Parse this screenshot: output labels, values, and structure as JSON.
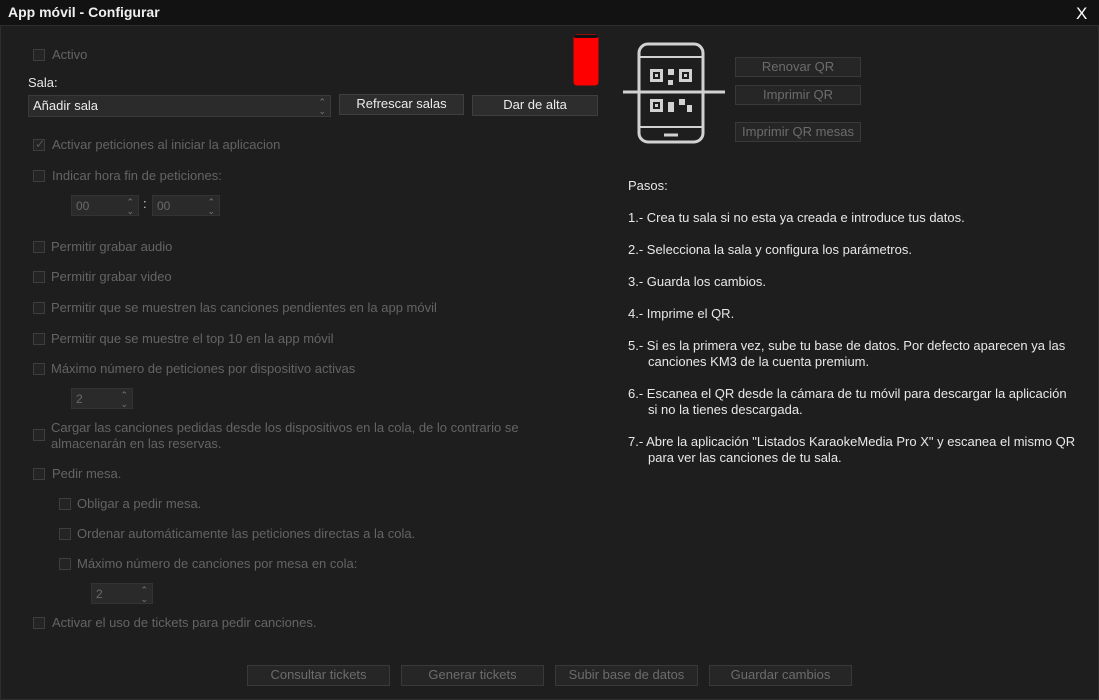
{
  "window": {
    "title": "App móvil - Configurar",
    "close_label": "X"
  },
  "settings": {
    "active_label": "Activo",
    "sala_label": "Sala:",
    "sala_selected": "Añadir sala",
    "refresh_rooms": "Refrescar salas",
    "register": "Dar de alta",
    "activate_requests": "Activar peticiones al iniciar la aplicacion",
    "end_time_label": "Indicar hora fin de peticiones:",
    "hour": "00",
    "time_sep": ":",
    "minute": "00",
    "allow_audio": "Permitir grabar audio",
    "allow_video": "Permitir grabar video",
    "show_pending": "Permitir que se muestren las canciones pendientes en la app móvil",
    "show_top10": "Permitir que se muestre el top 10 en la app móvil",
    "max_requests_label": "Máximo número de peticiones por dispositivo activas",
    "max_requests_value": "2",
    "load_queue_line1": "Cargar las canciones pedidas desde los dispositivos en la cola, de lo contrario se",
    "load_queue_line2": "almacenarán en las reservas.",
    "ask_table": "Pedir mesa.",
    "force_table": "Obligar a pedir mesa.",
    "auto_order": "Ordenar automáticamente las peticiones directas a la cola.",
    "max_songs_label": "Máximo número de canciones por mesa en cola:",
    "max_songs_value": "2",
    "tickets": "Activar el uso de tickets para pedir canciones."
  },
  "qr": {
    "renew": "Renovar QR",
    "print": "Imprimir QR",
    "print_tables": "Imprimir QR mesas"
  },
  "steps": {
    "heading": "Pasos:",
    "s1": "1.- Crea tu sala si no esta ya creada e introduce tus datos.",
    "s2": "2.- Selecciona la sala y configura los parámetros.",
    "s3": "3.- Guarda los cambios.",
    "s4": "4.- Imprime el QR.",
    "s5a": "5.- Si es la primera vez, sube tu base de datos. Por defecto aparecen ya las",
    "s5b": "canciones KM3 de la cuenta premium.",
    "s6a": "6.- Escanea el QR desde la cámara de tu móvil para descargar la aplicación",
    "s6b": "si no la tienes descargada.",
    "s7a": "7.- Abre la aplicación \"Listados KaraokeMedia Pro X\" y escanea el mismo QR",
    "s7b": "para ver las canciones de tu sala."
  },
  "footer": {
    "tickets": "Consultar tickets",
    "generate": "Generar tickets",
    "upload": "Subir base de datos",
    "save": "Guardar cambios"
  },
  "colors": {
    "status_phone": "#ff0000",
    "background": "#1e1e1e"
  },
  "icons": {
    "status": "phone-status-icon",
    "qr": "phone-qr-scan-icon",
    "close": "close-icon",
    "select_arrow": "updown-arrow-icon",
    "check": "checkmark-icon"
  }
}
